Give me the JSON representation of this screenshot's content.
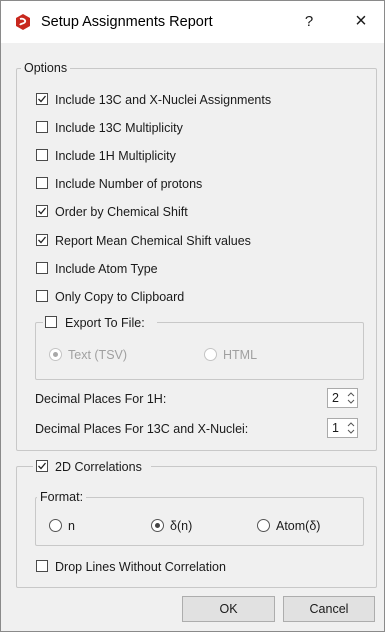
{
  "window": {
    "title": "Setup Assignments Report",
    "help_glyph": "?",
    "close_glyph": "×"
  },
  "options": {
    "title": "Options",
    "items": [
      {
        "label": "Include 13C and X-Nuclei Assignments",
        "checked": true
      },
      {
        "label": "Include 13C Multiplicity",
        "checked": false
      },
      {
        "label": "Include 1H Multiplicity",
        "checked": false
      },
      {
        "label": "Include Number of protons",
        "checked": false
      },
      {
        "label": "Order by Chemical Shift",
        "checked": true
      },
      {
        "label": "Report Mean Chemical Shift values",
        "checked": true
      },
      {
        "label": "Include Atom Type",
        "checked": false
      },
      {
        "label": "Only Copy to Clipboard",
        "checked": false
      }
    ],
    "export": {
      "label": "Export To File:",
      "checked": false,
      "formats": [
        {
          "label": "Text (TSV)",
          "selected": true
        },
        {
          "label": "HTML",
          "selected": false
        }
      ]
    },
    "decimal_1h": {
      "label": "Decimal Places For 1H:",
      "value": "2"
    },
    "decimal_13c": {
      "label": "Decimal Places For 13C and X-Nuclei:",
      "value": "1"
    }
  },
  "correlations": {
    "label": "2D Correlations",
    "checked": true,
    "format": {
      "title": "Format:",
      "options": [
        {
          "label": "n",
          "selected": false
        },
        {
          "label": "δ(n)",
          "selected": true
        },
        {
          "label": "Atom(δ)",
          "selected": false
        }
      ]
    },
    "drop_lines": {
      "label": "Drop Lines Without Correlation",
      "checked": false
    }
  },
  "buttons": {
    "ok": "OK",
    "cancel": "Cancel"
  },
  "colors": {
    "app_icon": "#c8281e",
    "window_bg": "#f0f0f0",
    "titlebar_bg": "#ffffff"
  }
}
